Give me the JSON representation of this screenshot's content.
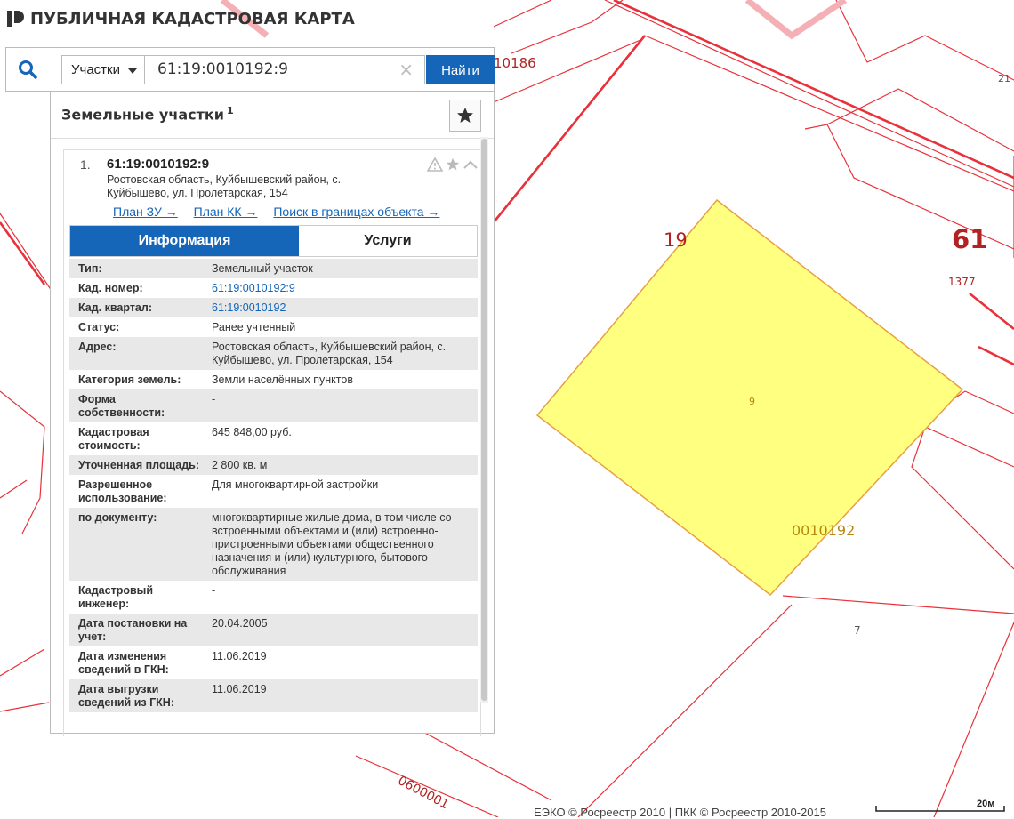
{
  "app": {
    "title": "ПУБЛИЧНАЯ КАДАСТРОВАЯ КАРТА",
    "logo_icon": "pkk-logo-icon"
  },
  "search": {
    "icon": "search-icon",
    "type_label": "Участки",
    "value": "61:19:0010192:9",
    "clear_icon": "clear-icon",
    "button_label": "Найти"
  },
  "panel": {
    "title": "Земельные участки",
    "count": "1",
    "favorite_icon": "star-icon"
  },
  "result": {
    "index": "1.",
    "cadastral_number": "61:19:0010192:9",
    "address": "Ростовская область, Куйбышевский район, с. Куйбышево, ул. Пролетарская, 154",
    "tool_icons": [
      "warning-icon",
      "star-icon",
      "chevron-up-icon"
    ],
    "links": [
      "План ЗУ →",
      "План КК →",
      "Поиск в границах объекта →"
    ],
    "tabs": [
      "Информация",
      "Услуги"
    ],
    "fields": [
      {
        "label": "Тип:",
        "value": "Земельный участок"
      },
      {
        "label": "Кад. номер:",
        "value": "61:19:0010192:9",
        "link": true
      },
      {
        "label": "Кад. квартал:",
        "value": "61:19:0010192",
        "link": true
      },
      {
        "label": "Статус:",
        "value": "Ранее учтенный"
      },
      {
        "label": "Адрес:",
        "value": "Ростовская область, Куйбышевский район, с. Куйбышево, ул. Пролетарская, 154"
      },
      {
        "label": "Категория земель:",
        "value": "Земли населённых пунктов"
      },
      {
        "label": "Форма собственности:",
        "value": "-"
      },
      {
        "label": "Кадастровая стоимость:",
        "value": "645 848,00 руб."
      },
      {
        "label": "Уточненная площадь:",
        "value": "2 800 кв. м"
      },
      {
        "label": "Разрешенное использование:",
        "value": "Для многоквартирной застройки"
      },
      {
        "label": "по документу:",
        "value": "многоквартирные жилые дома, в том числе со встроенными объектами и (или) встроенно-пристроенными объектами общественного назначения и (или) культурного, бытового обслуживания"
      },
      {
        "label": "Кадастровый инженер:",
        "value": "-"
      },
      {
        "label": "Дата постановки на учет:",
        "value": "20.04.2005"
      },
      {
        "label": "Дата изменения сведений в ГКН:",
        "value": "11.06.2019"
      },
      {
        "label": "Дата выгрузки сведений из ГКН:",
        "value": "11.06.2019"
      }
    ]
  },
  "map": {
    "labels": [
      "10186",
      "21",
      "19",
      "61",
      "1377",
      "9",
      "0010192",
      "7",
      "0600001"
    ],
    "parcel_fill": "#ffff80",
    "boundary_color": "#e8313a"
  },
  "footer": {
    "copyright": "ЕЭКО © Росреестр 2010 | ПКК © Росреестр 2010-2015",
    "scale": "20м"
  }
}
